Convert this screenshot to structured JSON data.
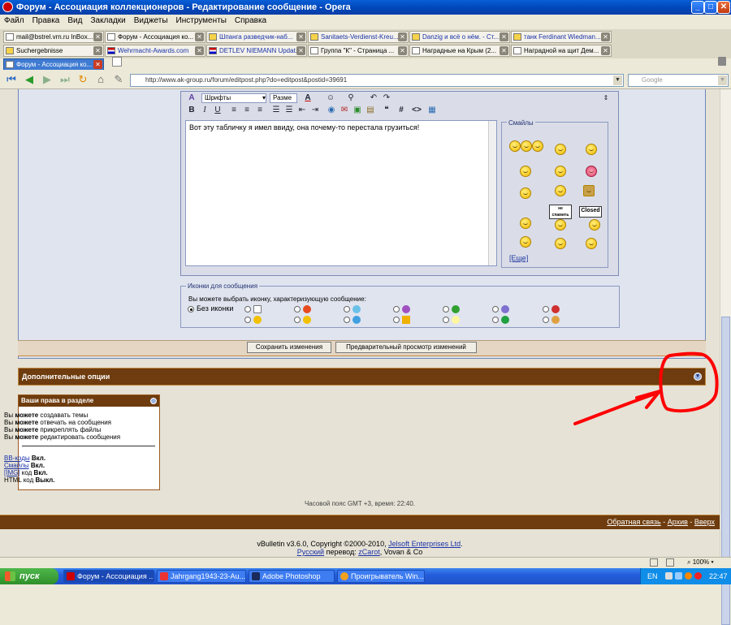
{
  "window": {
    "title": "Форум - Ассоциация коллекционеров - Редактирование сообщение - Opera"
  },
  "menu": [
    "Файл",
    "Правка",
    "Вид",
    "Закладки",
    "Виджеты",
    "Инструменты",
    "Справка"
  ],
  "tabs_row1": [
    "mail@bstrel.vrn.ru InBox...",
    "Форум - Ассоциация ко...",
    "Шпанга разведчик-наб...",
    "Sanitaets-Verdienst-Kreu...",
    "Danzig и всё о нём. - Ст...",
    "танк Ferdinant Wiedman..."
  ],
  "tabs_row2": [
    "Suchergebnisse",
    "Wehrmacht-Awards.com",
    "DETLEV NIEMANN Updat...",
    "Группа \"К\" - Страница ...",
    "Наградные на Крым (2...",
    "Наградной на щит Дем..."
  ],
  "tabs_row3": [
    "Форум - Ассоциация ко..."
  ],
  "address": {
    "url": "http://www.ak-group.ru/forum/editpost.php?do=editpost&postid=39691",
    "search_placeholder": "Google"
  },
  "editor": {
    "font_select": "Шрифты",
    "size_select": "Разме",
    "message": "Вот эту табличку я имел ввиду, она почему-то перестала грузиться!",
    "smilies_label": "Смайлы",
    "sign_labels": [
      "не спамить",
      "Closed"
    ],
    "more_link": "[Еще]"
  },
  "post_icons": {
    "label": "Иконки для сообщения",
    "description": "Вы можете выбрать иконку, характеризующую сообщение:",
    "no_icon": "Без иконки"
  },
  "buttons": {
    "save": "Сохранить изменения",
    "preview": "Предварительный просмотр изменений"
  },
  "extra": {
    "title": "Дополнительные опции"
  },
  "rights": {
    "title": "Ваши права в разделе",
    "lines": [
      {
        "pre": "Вы ",
        "bold": "можете",
        "post": " создавать темы"
      },
      {
        "pre": "Вы ",
        "bold": "можете",
        "post": " отвечать на сообщения"
      },
      {
        "pre": "Вы ",
        "bold": "можете",
        "post": " прикреплять файлы"
      },
      {
        "pre": "Вы ",
        "bold": "можете",
        "post": " редактировать сообщения"
      }
    ],
    "codes": [
      {
        "name": "BB-коды",
        "state": "Вкл.",
        "link": true
      },
      {
        "name": "Смайлы",
        "state": "Вкл.",
        "link": true
      },
      {
        "name": "[IMG]",
        "mid": " код ",
        "state": "Вкл.",
        "link": true
      },
      {
        "name": "HTML код",
        "state": "Выкл.",
        "link": false
      }
    ]
  },
  "timezone": "Часовой пояс GMT +3, время: 22:40.",
  "footer": {
    "links": [
      "Обратная связь",
      "Архив",
      "Вверх"
    ],
    "sep": " - ",
    "copyright_pre": "vBulletin v3.6.0, Copyright ©2000-2010, ",
    "copyright_link": "Jelsoft Enterprises Ltd",
    "copyright_post": ".",
    "translation_link": "Русский",
    "translation_mid": " перевод: ",
    "translation_author": "zCarot",
    "translation_post": ", Vovan & Co"
  },
  "status": {
    "zoom": "100%"
  },
  "taskbar": {
    "start": "пуск",
    "tasks": [
      "Форум - Ассоциация ...",
      "Jahrgang1943-23-Au...",
      "Adobe Photoshop",
      "Проигрыватель Win..."
    ],
    "lang": "EN",
    "clock": "22:47"
  },
  "colors": {
    "forum_brown": "#6e3c0e",
    "editor_blue": "#dfe4ef",
    "annotation_red": "#ff0000"
  }
}
